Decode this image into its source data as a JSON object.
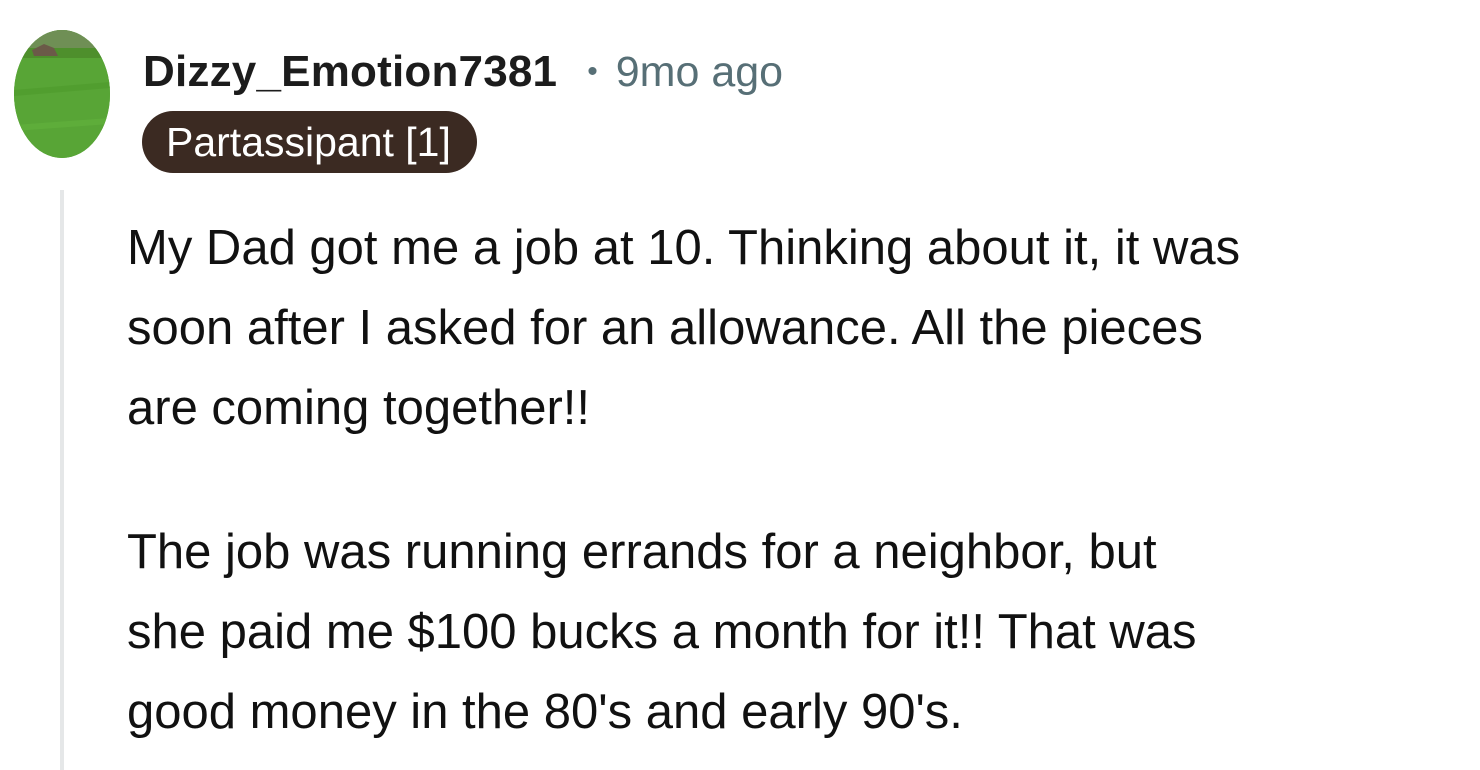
{
  "comment": {
    "avatar_icon": "user-avatar-grass",
    "username": "Dizzy_Emotion7381",
    "separator": "•",
    "age": "9mo ago",
    "flair": "Partassipant [1]",
    "flair_color": "#3b2a22",
    "paragraphs": [
      "My Dad got me a job at 10. Thinking about it, it was\nsoon after I asked for an allowance. All the pieces\nare coming together!!",
      "The job was running errands for a neighbor, but\nshe paid me $100 bucks a month for it!! That was\ngood money in the 80's and early 90's."
    ]
  }
}
